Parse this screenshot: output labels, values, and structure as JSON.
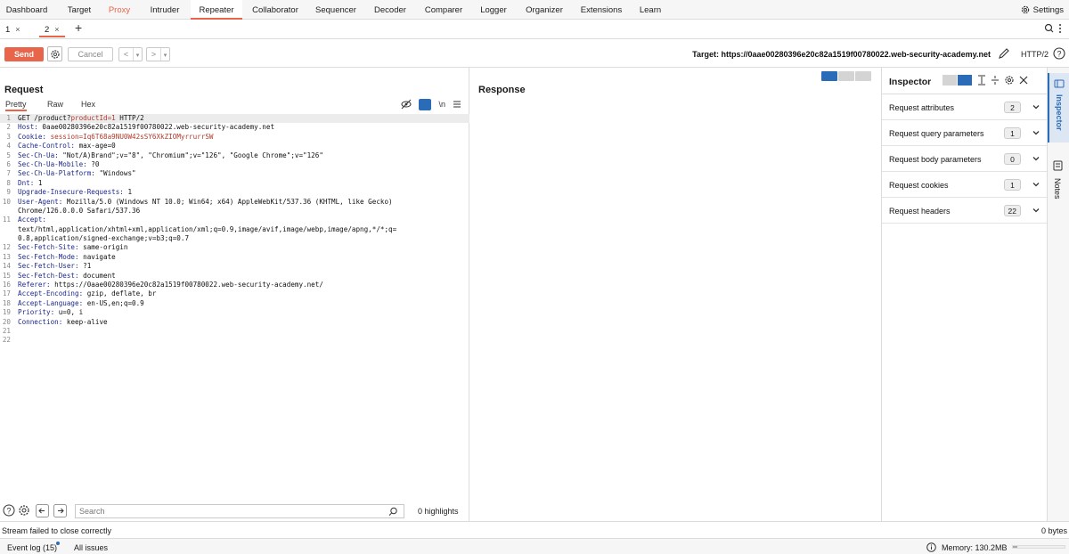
{
  "menu": {
    "tabs": [
      "Dashboard",
      "Target",
      "Proxy",
      "Intruder",
      "Repeater",
      "Collaborator",
      "Sequencer",
      "Decoder",
      "Comparer",
      "Logger",
      "Organizer",
      "Extensions",
      "Learn"
    ],
    "active": "Repeater",
    "settings_label": "Settings"
  },
  "repeater_tabs": [
    {
      "label": "1",
      "close": "×"
    },
    {
      "label": "2",
      "close": "×"
    }
  ],
  "new_tab": "+",
  "toolbar": {
    "send": "Send",
    "cancel": "Cancel",
    "back": "<",
    "forward": ">",
    "target": "Target: https://0aae00280396e20c82a1519f00780022.web-security-academy.net",
    "http_version": "HTTP/2"
  },
  "request": {
    "title": "Request",
    "tabs": [
      "Pretty",
      "Raw",
      "Hex"
    ],
    "active_tab": "Pretty",
    "newline_toggle": "\\n",
    "lines": [
      {
        "n": "1",
        "key": "GET /product?",
        "val": "productId=1",
        "rest": " HTTP/2"
      },
      {
        "n": "2",
        "key": "Host:",
        "rest": " 0aae00280396e20c82a1519f00780022.web-security-academy.net"
      },
      {
        "n": "3",
        "key": "Cookie:",
        "rest": " ",
        "val": "session=Iq6T68a9NU0W42sSY6XkZIOMyrrurrSW"
      },
      {
        "n": "4",
        "key": "Cache-Control:",
        "rest": " max-age=0"
      },
      {
        "n": "5",
        "key": "Sec-Ch-Ua:",
        "rest": " \"Not/A)Brand\";v=\"8\", \"Chromium\";v=\"126\", \"Google Chrome\";v=\"126\""
      },
      {
        "n": "6",
        "key": "Sec-Ch-Ua-Mobile:",
        "rest": " ?0"
      },
      {
        "n": "7",
        "key": "Sec-Ch-Ua-Platform:",
        "rest": " \"Windows\""
      },
      {
        "n": "8",
        "key": "Dnt:",
        "rest": " 1"
      },
      {
        "n": "9",
        "key": "Upgrade-Insecure-Requests:",
        "rest": " 1"
      },
      {
        "n": "10",
        "key": "User-Agent:",
        "rest": " Mozilla/5.0 (Windows NT 10.0; Win64; x64) AppleWebKit/537.36 (KHTML, like Gecko)"
      },
      {
        "n": "",
        "key": "",
        "rest": "Chrome/126.0.0.0 Safari/537.36"
      },
      {
        "n": "11",
        "key": "Accept:",
        "rest": ""
      },
      {
        "n": "",
        "key": "",
        "rest": "text/html,application/xhtml+xml,application/xml;q=0.9,image/avif,image/webp,image/apng,*/*;q="
      },
      {
        "n": "",
        "key": "",
        "rest": "0.8,application/signed-exchange;v=b3;q=0.7"
      },
      {
        "n": "12",
        "key": "Sec-Fetch-Site:",
        "rest": " same-origin"
      },
      {
        "n": "13",
        "key": "Sec-Fetch-Mode:",
        "rest": " navigate"
      },
      {
        "n": "14",
        "key": "Sec-Fetch-User:",
        "rest": " ?1"
      },
      {
        "n": "15",
        "key": "Sec-Fetch-Dest:",
        "rest": " document"
      },
      {
        "n": "16",
        "key": "Referer:",
        "rest": " https://0aae00280396e20c82a1519f00780022.web-security-academy.net/"
      },
      {
        "n": "17",
        "key": "Accept-Encoding:",
        "rest": " gzip, deflate, br"
      },
      {
        "n": "18",
        "key": "Accept-Language:",
        "rest": " en-US,en;q=0.9"
      },
      {
        "n": "19",
        "key": "Priority:",
        "rest": " u=0, i"
      },
      {
        "n": "20",
        "key": "Connection:",
        "rest": " keep-alive"
      },
      {
        "n": "21",
        "key": "",
        "rest": ""
      },
      {
        "n": "22",
        "key": "",
        "rest": ""
      }
    ],
    "search_placeholder": "Search",
    "highlights": "0 highlights"
  },
  "response": {
    "title": "Response"
  },
  "inspector": {
    "title": "Inspector",
    "rows": [
      {
        "label": "Request attributes",
        "count": "2"
      },
      {
        "label": "Request query parameters",
        "count": "1"
      },
      {
        "label": "Request body parameters",
        "count": "0"
      },
      {
        "label": "Request cookies",
        "count": "1"
      },
      {
        "label": "Request headers",
        "count": "22"
      }
    ]
  },
  "side_tabs": {
    "inspector": "Inspector",
    "notes": "Notes"
  },
  "status": {
    "message": "Stream failed to close correctly",
    "bytes": "0 bytes"
  },
  "bottom": {
    "event_log": "Event log (15)",
    "all_issues": "All issues",
    "memory": "Memory: 130.2MB",
    "memory_fraction": 0.08
  },
  "colors": {
    "accent": "#e8644a",
    "blue": "#2b6cb8"
  }
}
